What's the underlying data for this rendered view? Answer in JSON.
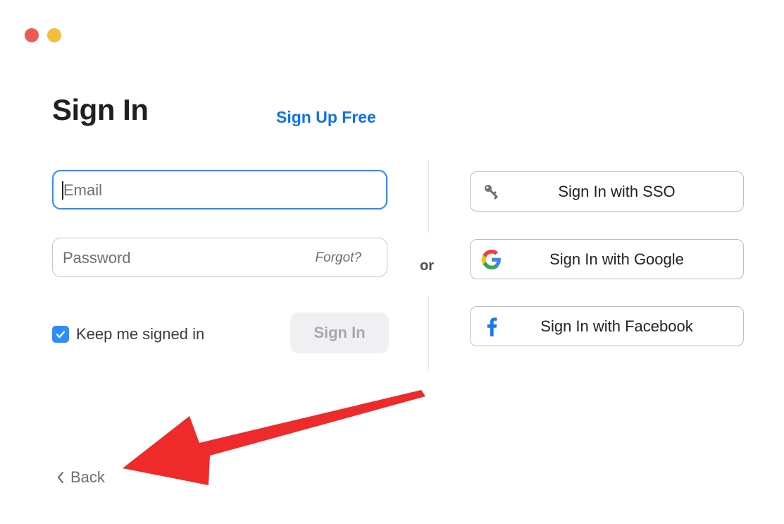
{
  "window": {
    "controls": [
      "close",
      "minimize"
    ]
  },
  "header": {
    "title": "Sign In",
    "signup_link": "Sign Up Free"
  },
  "form": {
    "email": {
      "placeholder": "Email",
      "value": ""
    },
    "password": {
      "placeholder": "Password",
      "value": ""
    },
    "forgot_link": "Forgot?",
    "keep_signed_in": {
      "label": "Keep me signed in",
      "checked": true
    },
    "submit_label": "Sign In"
  },
  "divider_text": "or",
  "social": [
    {
      "label": "Sign In with SSO",
      "icon": "key-icon"
    },
    {
      "label": "Sign In with Google",
      "icon": "google-icon"
    },
    {
      "label": "Sign In with Facebook",
      "icon": "facebook-icon"
    }
  ],
  "footer": {
    "back_label": "Back"
  },
  "colors": {
    "accent": "#0e72ed",
    "focus": "#2d8cff",
    "annotation": "#ee2a2a"
  }
}
